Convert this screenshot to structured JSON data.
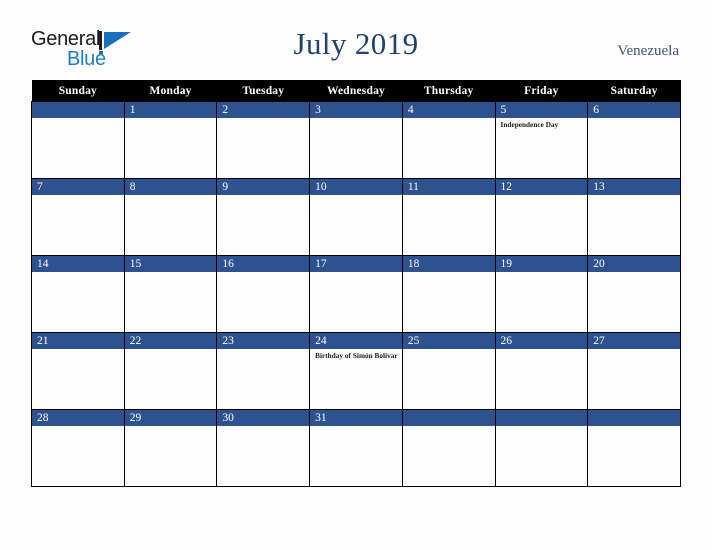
{
  "brand": {
    "name_top": "General",
    "name_bottom": "Blue",
    "mark_icon": "triangle-logo-icon",
    "color_dark": "#1b1b1b",
    "color_blue": "#1d7cc4"
  },
  "header": {
    "title": "July 2019",
    "region": "Venezuela",
    "title_color": "#23416b"
  },
  "calendar": {
    "accent_color": "#2e5190",
    "header_bg": "#000000",
    "weekday_headers": [
      "Sunday",
      "Monday",
      "Tuesday",
      "Wednesday",
      "Thursday",
      "Friday",
      "Saturday"
    ],
    "weeks": [
      [
        {
          "day": "",
          "events": []
        },
        {
          "day": "1",
          "events": []
        },
        {
          "day": "2",
          "events": []
        },
        {
          "day": "3",
          "events": []
        },
        {
          "day": "4",
          "events": []
        },
        {
          "day": "5",
          "events": [
            "Independence Day"
          ]
        },
        {
          "day": "6",
          "events": []
        }
      ],
      [
        {
          "day": "7",
          "events": []
        },
        {
          "day": "8",
          "events": []
        },
        {
          "day": "9",
          "events": []
        },
        {
          "day": "10",
          "events": []
        },
        {
          "day": "11",
          "events": []
        },
        {
          "day": "12",
          "events": []
        },
        {
          "day": "13",
          "events": []
        }
      ],
      [
        {
          "day": "14",
          "events": []
        },
        {
          "day": "15",
          "events": []
        },
        {
          "day": "16",
          "events": []
        },
        {
          "day": "17",
          "events": []
        },
        {
          "day": "18",
          "events": []
        },
        {
          "day": "19",
          "events": []
        },
        {
          "day": "20",
          "events": []
        }
      ],
      [
        {
          "day": "21",
          "events": []
        },
        {
          "day": "22",
          "events": []
        },
        {
          "day": "23",
          "events": []
        },
        {
          "day": "24",
          "events": [
            "Birthday of Simón Bolívar"
          ]
        },
        {
          "day": "25",
          "events": []
        },
        {
          "day": "26",
          "events": []
        },
        {
          "day": "27",
          "events": []
        }
      ],
      [
        {
          "day": "28",
          "events": []
        },
        {
          "day": "29",
          "events": []
        },
        {
          "day": "30",
          "events": []
        },
        {
          "day": "31",
          "events": []
        },
        {
          "day": "",
          "events": []
        },
        {
          "day": "",
          "events": []
        },
        {
          "day": "",
          "events": []
        }
      ]
    ]
  }
}
